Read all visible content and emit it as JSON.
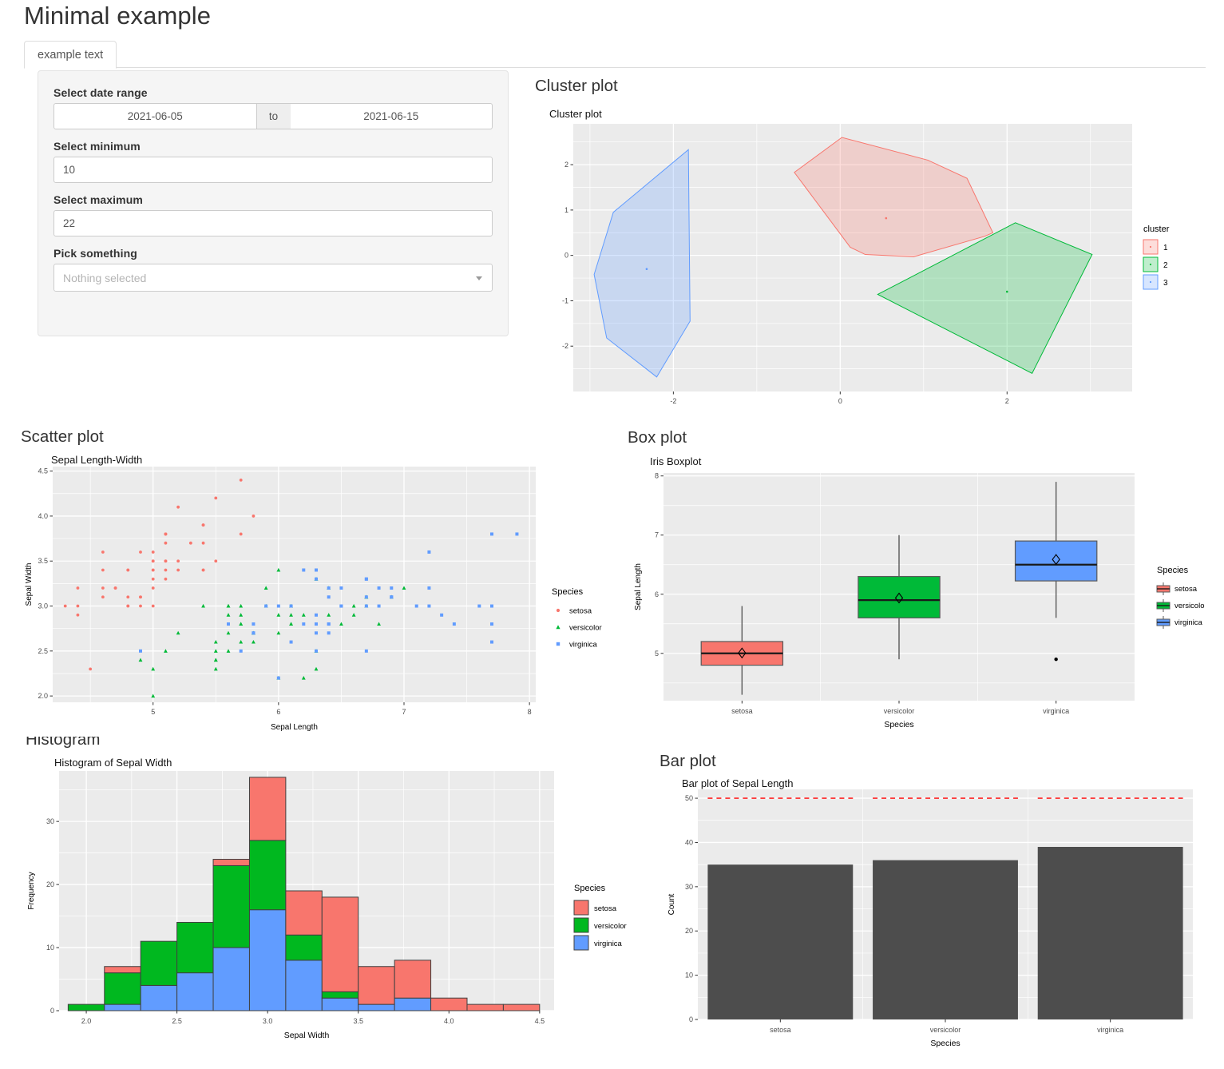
{
  "app": {
    "title": "Minimal example"
  },
  "tabs": [
    {
      "label": "example text",
      "active": true
    }
  ],
  "form": {
    "date_range": {
      "label": "Select date range",
      "start": "2021-06-05",
      "separator": "to",
      "end": "2021-06-15"
    },
    "minimum": {
      "label": "Select minimum",
      "value": "10"
    },
    "maximum": {
      "label": "Select maximum",
      "value": "22"
    },
    "picker": {
      "label": "Pick something",
      "value": "Nothing selected"
    }
  },
  "sections": {
    "cluster": "Cluster plot",
    "scatter": "Scatter plot",
    "box": "Box plot",
    "histogram": "Histogram",
    "bar": "Bar plot"
  },
  "colors": {
    "setosa": "#F8766D",
    "versicolor": "#00BA38",
    "virginica": "#619CFF",
    "hist_setosa": "#F8766D",
    "hist_versicolor": "#00B81F",
    "hist_virginica": "#619CFF",
    "bar_fill": "#4d4d4d",
    "threshold_line": "#FF0000",
    "panel_bg": "#EBEBEB",
    "grid": "#FFFFFF",
    "cluster1": "#F8766D",
    "cluster2": "#00BA38",
    "cluster3": "#619CFF"
  },
  "chart_data": [
    {
      "id": "cluster-plot",
      "type": "scatter",
      "title": "Cluster plot",
      "xlabel": "",
      "ylabel": "",
      "xlim": [
        -3.2,
        3.5
      ],
      "ylim": [
        -3.0,
        2.9
      ],
      "xticks": [
        -2,
        0,
        2
      ],
      "yticks": [
        -2,
        -1,
        0,
        1,
        2
      ],
      "grid": true,
      "legend": {
        "title": "cluster",
        "position": "right",
        "entries": [
          "1",
          "2",
          "3"
        ]
      },
      "series": [
        {
          "name": "1",
          "color": "#F8766D",
          "hull": [
            [
              -0.55,
              1.83
            ],
            [
              0.02,
              2.6
            ],
            [
              1.05,
              2.1
            ],
            [
              1.52,
              1.7
            ],
            [
              1.83,
              0.5
            ],
            [
              1.73,
              0.42
            ],
            [
              0.88,
              -0.03
            ],
            [
              0.3,
              0.02
            ],
            [
              0.12,
              0.18
            ],
            [
              -0.55,
              1.83
            ]
          ],
          "center": [
            0.55,
            0.82
          ]
        },
        {
          "name": "2",
          "color": "#00BA38",
          "hull": [
            [
              0.45,
              -0.86
            ],
            [
              2.1,
              0.72
            ],
            [
              3.02,
              0.02
            ],
            [
              2.3,
              -2.6
            ],
            [
              0.45,
              -0.86
            ]
          ],
          "center": [
            2.0,
            -0.8
          ]
        },
        {
          "name": "3",
          "color": "#619CFF",
          "hull": [
            [
              -1.82,
              2.33
            ],
            [
              -1.8,
              -1.45
            ],
            [
              -2.2,
              -2.68
            ],
            [
              -2.8,
              -1.82
            ],
            [
              -2.95,
              -0.42
            ],
            [
              -2.72,
              0.95
            ],
            [
              -1.82,
              2.33
            ]
          ],
          "center": [
            -2.32,
            -0.3
          ]
        }
      ]
    },
    {
      "id": "scatter-plot",
      "type": "scatter",
      "title": "Sepal Length-Width",
      "xlabel": "Sepal Length",
      "ylabel": "Sepal Width",
      "xlim": [
        4.2,
        8.05
      ],
      "ylim": [
        1.93,
        4.55
      ],
      "xticks": [
        5,
        6,
        7,
        8
      ],
      "yticks": [
        2.0,
        2.5,
        3.0,
        3.5,
        4.0,
        4.5
      ],
      "grid": true,
      "legend": {
        "title": "Species",
        "position": "right",
        "entries": [
          "setosa",
          "versicolor",
          "virginica"
        ]
      },
      "series": [
        {
          "name": "setosa",
          "color": "#F8766D",
          "shape": "circle",
          "points": [
            [
              5.1,
              3.5
            ],
            [
              4.9,
              3.0
            ],
            [
              4.7,
              3.2
            ],
            [
              4.6,
              3.1
            ],
            [
              5.0,
              3.6
            ],
            [
              5.4,
              3.9
            ],
            [
              4.6,
              3.4
            ],
            [
              5.0,
              3.4
            ],
            [
              4.4,
              2.9
            ],
            [
              4.9,
              3.1
            ],
            [
              5.4,
              3.7
            ],
            [
              4.8,
              3.4
            ],
            [
              4.8,
              3.0
            ],
            [
              4.3,
              3.0
            ],
            [
              5.8,
              4.0
            ],
            [
              5.7,
              4.4
            ],
            [
              5.4,
              3.9
            ],
            [
              5.1,
              3.5
            ],
            [
              5.7,
              3.8
            ],
            [
              5.1,
              3.8
            ],
            [
              5.4,
              3.4
            ],
            [
              5.1,
              3.7
            ],
            [
              4.6,
              3.6
            ],
            [
              5.1,
              3.3
            ],
            [
              4.8,
              3.4
            ],
            [
              5.0,
              3.0
            ],
            [
              5.0,
              3.4
            ],
            [
              5.2,
              3.5
            ],
            [
              5.2,
              3.4
            ],
            [
              4.7,
              3.2
            ],
            [
              4.8,
              3.1
            ],
            [
              5.4,
              3.4
            ],
            [
              5.2,
              4.1
            ],
            [
              5.5,
              4.2
            ],
            [
              4.9,
              3.1
            ],
            [
              5.0,
              3.2
            ],
            [
              5.5,
              3.5
            ],
            [
              4.9,
              3.6
            ],
            [
              4.4,
              3.0
            ],
            [
              5.1,
              3.4
            ],
            [
              5.0,
              3.5
            ],
            [
              4.5,
              2.3
            ],
            [
              4.4,
              3.2
            ],
            [
              5.0,
              3.5
            ],
            [
              5.1,
              3.8
            ],
            [
              4.8,
              3.0
            ],
            [
              5.1,
              3.8
            ],
            [
              4.6,
              3.2
            ],
            [
              5.3,
              3.7
            ],
            [
              5.0,
              3.3
            ]
          ]
        },
        {
          "name": "versicolor",
          "color": "#00BA38",
          "shape": "triangle",
          "points": [
            [
              7.0,
              3.2
            ],
            [
              6.4,
              3.2
            ],
            [
              6.9,
              3.1
            ],
            [
              5.5,
              2.3
            ],
            [
              6.5,
              2.8
            ],
            [
              5.7,
              2.8
            ],
            [
              6.3,
              3.3
            ],
            [
              4.9,
              2.4
            ],
            [
              6.6,
              2.9
            ],
            [
              5.2,
              2.7
            ],
            [
              5.0,
              2.0
            ],
            [
              5.9,
              3.0
            ],
            [
              6.0,
              2.2
            ],
            [
              6.1,
              2.9
            ],
            [
              5.6,
              2.9
            ],
            [
              6.7,
              3.1
            ],
            [
              5.6,
              3.0
            ],
            [
              5.8,
              2.7
            ],
            [
              6.2,
              2.2
            ],
            [
              5.6,
              2.5
            ],
            [
              5.9,
              3.2
            ],
            [
              6.1,
              2.8
            ],
            [
              6.3,
              2.5
            ],
            [
              6.1,
              2.8
            ],
            [
              6.4,
              2.9
            ],
            [
              6.6,
              3.0
            ],
            [
              6.8,
              2.8
            ],
            [
              6.7,
              3.0
            ],
            [
              6.0,
              2.9
            ],
            [
              5.7,
              2.6
            ],
            [
              5.5,
              2.4
            ],
            [
              5.5,
              2.4
            ],
            [
              5.8,
              2.7
            ],
            [
              6.0,
              2.7
            ],
            [
              5.4,
              3.0
            ],
            [
              6.0,
              3.4
            ],
            [
              6.7,
              3.1
            ],
            [
              6.3,
              2.3
            ],
            [
              5.6,
              3.0
            ],
            [
              5.5,
              2.5
            ],
            [
              5.5,
              2.6
            ],
            [
              6.1,
              3.0
            ],
            [
              5.8,
              2.6
            ],
            [
              5.0,
              2.3
            ],
            [
              5.6,
              2.7
            ],
            [
              5.7,
              3.0
            ],
            [
              5.7,
              2.9
            ],
            [
              6.2,
              2.9
            ],
            [
              5.1,
              2.5
            ],
            [
              5.7,
              2.8
            ]
          ]
        },
        {
          "name": "virginica",
          "color": "#619CFF",
          "shape": "square",
          "points": [
            [
              6.3,
              3.3
            ],
            [
              5.8,
              2.7
            ],
            [
              7.1,
              3.0
            ],
            [
              6.3,
              2.9
            ],
            [
              6.5,
              3.0
            ],
            [
              7.6,
              3.0
            ],
            [
              4.9,
              2.5
            ],
            [
              7.3,
              2.9
            ],
            [
              6.7,
              2.5
            ],
            [
              7.2,
              3.6
            ],
            [
              6.5,
              3.2
            ],
            [
              6.4,
              2.7
            ],
            [
              6.8,
              3.0
            ],
            [
              5.7,
              2.5
            ],
            [
              5.8,
              2.8
            ],
            [
              6.4,
              3.2
            ],
            [
              6.5,
              3.0
            ],
            [
              7.7,
              3.8
            ],
            [
              7.7,
              2.6
            ],
            [
              6.0,
              2.2
            ],
            [
              6.9,
              3.2
            ],
            [
              5.6,
              2.8
            ],
            [
              7.7,
              2.8
            ],
            [
              6.3,
              2.7
            ],
            [
              6.7,
              3.3
            ],
            [
              7.2,
              3.2
            ],
            [
              6.2,
              2.8
            ],
            [
              6.1,
              3.0
            ],
            [
              6.4,
              2.8
            ],
            [
              7.2,
              3.0
            ],
            [
              7.4,
              2.8
            ],
            [
              7.9,
              3.8
            ],
            [
              6.4,
              2.8
            ],
            [
              6.3,
              2.8
            ],
            [
              6.1,
              2.6
            ],
            [
              7.7,
              3.0
            ],
            [
              6.3,
              3.4
            ],
            [
              6.4,
              3.1
            ],
            [
              6.0,
              3.0
            ],
            [
              6.9,
              3.1
            ],
            [
              6.7,
              3.1
            ],
            [
              6.9,
              3.1
            ],
            [
              5.8,
              2.7
            ],
            [
              6.8,
              3.2
            ],
            [
              6.7,
              3.3
            ],
            [
              6.7,
              3.0
            ],
            [
              6.3,
              2.5
            ],
            [
              6.5,
              3.0
            ],
            [
              6.2,
              3.4
            ],
            [
              5.9,
              3.0
            ]
          ]
        }
      ]
    },
    {
      "id": "box-plot",
      "type": "box",
      "title": "Iris Boxplot",
      "xlabel": "Species",
      "ylabel": "Sepal Length",
      "categories": [
        "setosa",
        "versicolor",
        "virginica"
      ],
      "xticklabels": [
        "setosa",
        "versicolor",
        "virginica"
      ],
      "yticks": [
        5,
        6,
        7,
        8
      ],
      "ylim": [
        4.2,
        8.05
      ],
      "grid": true,
      "legend": {
        "title": "Species",
        "position": "right",
        "entries": [
          "setosa",
          "versicolo",
          "virginica"
        ]
      },
      "boxes": [
        {
          "name": "setosa",
          "color": "#F8766D",
          "min": 4.3,
          "q1": 4.8,
          "median": 5.0,
          "q3": 5.2,
          "max": 5.8,
          "mean": 5.006,
          "outliers": []
        },
        {
          "name": "versicolor",
          "color": "#00BA38",
          "min": 4.9,
          "q1": 5.6,
          "median": 5.9,
          "q3": 6.3,
          "max": 7.0,
          "mean": 5.936,
          "outliers": []
        },
        {
          "name": "virginica",
          "color": "#619CFF",
          "min": 5.6,
          "q1": 6.225,
          "median": 6.5,
          "q3": 6.9,
          "max": 7.9,
          "mean": 6.588,
          "outliers": [
            4.9
          ]
        }
      ]
    },
    {
      "id": "histogram",
      "type": "bar",
      "title": "Histogram of Sepal Width",
      "xlabel": "Sepal Width",
      "ylabel": "Frequency",
      "xticks": [
        2.0,
        2.5,
        3.0,
        3.5,
        4.0,
        4.5
      ],
      "yticks": [
        0,
        10,
        20,
        30
      ],
      "xlim": [
        1.85,
        4.58
      ],
      "ylim": [
        0,
        38
      ],
      "grid": true,
      "stacked": true,
      "bin_width": 0.2,
      "bin_starts": [
        1.9,
        2.1,
        2.3,
        2.5,
        2.7,
        2.9,
        3.1,
        3.3,
        3.5,
        3.7,
        3.9,
        4.1,
        4.3
      ],
      "legend": {
        "title": "Species",
        "position": "right",
        "entries": [
          "setosa",
          "versicolor",
          "virginica"
        ]
      },
      "series": [
        {
          "name": "virginica",
          "color": "#619CFF",
          "values": [
            0,
            1,
            4,
            6,
            10,
            16,
            8,
            2,
            1,
            2,
            0,
            0,
            0
          ]
        },
        {
          "name": "versicolor",
          "color": "#00B81F",
          "values": [
            1,
            5,
            7,
            8,
            13,
            11,
            4,
            1,
            0,
            0,
            0,
            0,
            0
          ]
        },
        {
          "name": "setosa",
          "color": "#F8766D",
          "values": [
            0,
            1,
            0,
            0,
            1,
            10,
            7,
            15,
            6,
            6,
            2,
            1,
            1
          ]
        }
      ],
      "totals": [
        1,
        7,
        11,
        14,
        24,
        37,
        19,
        18,
        7,
        8,
        2,
        1,
        1
      ]
    },
    {
      "id": "bar-plot",
      "type": "bar",
      "title": "Bar plot of Sepal Length",
      "xlabel": "Species",
      "ylabel": "Count",
      "categories": [
        "setosa",
        "versicolor",
        "virginica"
      ],
      "values": [
        35,
        36,
        39
      ],
      "yticks": [
        0,
        10,
        20,
        30,
        40,
        50
      ],
      "ylim": [
        0,
        52
      ],
      "grid": true,
      "bar_color": "#4d4d4d",
      "threshold": {
        "value": 50,
        "color": "#FF0000",
        "style": "dashed"
      }
    }
  ]
}
